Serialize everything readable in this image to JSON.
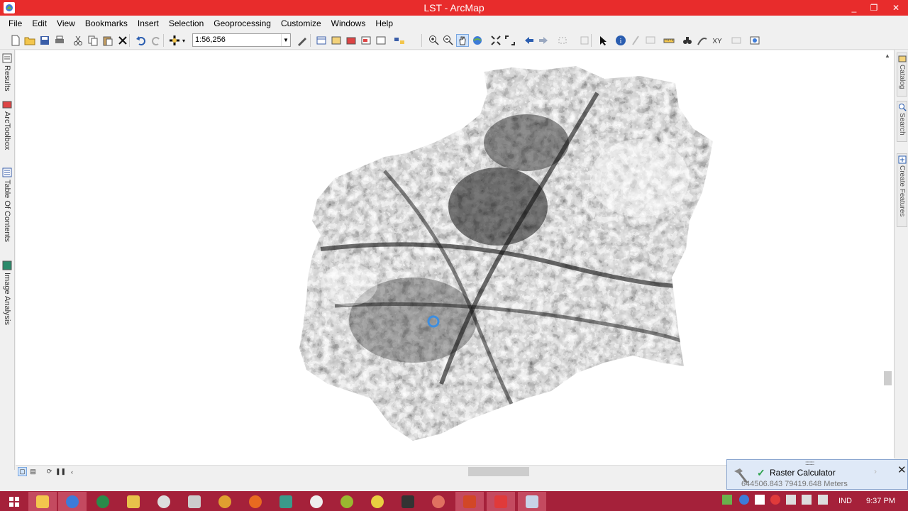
{
  "window": {
    "title": "LST - ArcMap",
    "min": "_",
    "max": "❐",
    "close": "✕"
  },
  "menu": [
    "File",
    "Edit",
    "View",
    "Bookmarks",
    "Insert",
    "Selection",
    "Geoprocessing",
    "Customize",
    "Windows",
    "Help"
  ],
  "toolbar": {
    "scale_value": "1:56,256"
  },
  "left_dock": {
    "results": "Results",
    "arctoolbox": "ArcToolbox",
    "toc": "Table Of Contents",
    "image_analysis": "Image Analysis"
  },
  "right_dock": {
    "catalog": "Catalog",
    "search": "Search",
    "create_features": "Create Features"
  },
  "status": {
    "coordinates": "644506.843  79419.648 Meters"
  },
  "popup": {
    "title": "Raster Calculator",
    "close": "✕",
    "grip": "::::::::::"
  },
  "taskbar": {
    "language": "IND",
    "time": "9:37 PM"
  },
  "colors": {
    "titlebar": "#e82c2c",
    "taskbar": "#a5213a",
    "accent_blue": "#3d7bd8"
  },
  "icons": [
    "new-document-icon",
    "open-folder-icon",
    "save-icon",
    "print-icon",
    "cut-icon",
    "copy-icon",
    "paste-icon",
    "delete-icon",
    "undo-icon",
    "redo-icon",
    "add-data-icon",
    "zoom-in-icon",
    "zoom-out-icon",
    "pan-icon",
    "full-extent-icon",
    "back-extent-icon",
    "forward-extent-icon",
    "select-icon",
    "identify-icon",
    "find-icon",
    "hammer-icon"
  ]
}
